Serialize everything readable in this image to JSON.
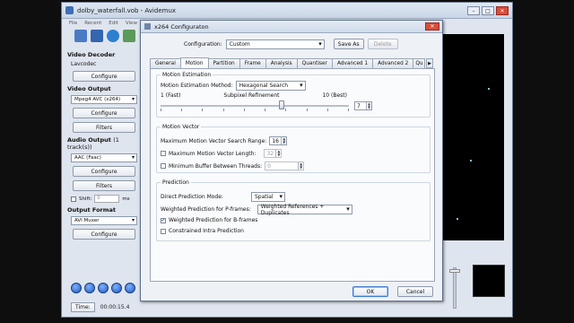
{
  "main_window": {
    "title": "dolby_waterfall.vob - Avidemux",
    "menu": [
      "File",
      "Recent",
      "Edit",
      "View"
    ],
    "video_decoder": {
      "title": "Video Decoder",
      "decoder": "Lavcodec",
      "configure": "Configure"
    },
    "video_output": {
      "title": "Video Output",
      "codec": "Mpeg4 AVC (x264)",
      "configure": "Configure",
      "filters": "Filters"
    },
    "audio_output": {
      "title": "Audio Output",
      "tracks": "(1 track(s))",
      "codec": "AAC (Faac)",
      "configure": "Configure",
      "filters": "Filters",
      "shift_label": "Shift:",
      "shift_value": "0",
      "shift_unit": "ms"
    },
    "output_format": {
      "title": "Output Format",
      "format": "AVI Muxer",
      "configure": "Configure"
    },
    "time": {
      "button": "Time:",
      "value": "00:00:15.4"
    }
  },
  "dialog": {
    "title": "x264 Configuraton",
    "close": "✕",
    "configuration_label": "Configuration:",
    "configuration_value": "Custom",
    "save_as": "Save As",
    "delete": "Delete",
    "tabs": [
      "General",
      "Motion",
      "Partition",
      "Frame",
      "Analysis",
      "Quantiser",
      "Advanced 1",
      "Advanced 2",
      "Qu"
    ],
    "active_tab": "Motion",
    "motion_estimation": {
      "title": "Motion Estimation",
      "method_label": "Motion Estimation Method:",
      "method_value": "Hexagonal Search",
      "scale_min": "1 (Fast)",
      "scale_mid": "Subpixel Refinement",
      "scale_max": "10 (Best)",
      "subpixel_value": "7"
    },
    "motion_vector": {
      "title": "Motion Vector",
      "max_search_label": "Maximum Motion Vector Search Range:",
      "max_search_value": "16",
      "max_length_label": "Maximum Motion Vector Length:",
      "max_length_value": "32",
      "min_buffer_label": "Minimum Buffer Between Threads:",
      "min_buffer_value": "0"
    },
    "prediction": {
      "title": "Prediction",
      "direct_label": "Direct Prediction Mode:",
      "direct_value": "Spatial",
      "weighted_p_label": "Weighted Prediction for P-frames:",
      "weighted_p_value": "Weighted References + Duplicates",
      "weighted_b_label": "Weighted Prediction for B-frames",
      "weighted_b_checked": true,
      "constrained_label": "Constrained Intra Prediction",
      "constrained_checked": false
    },
    "ok": "OK",
    "cancel": "Cancel"
  }
}
